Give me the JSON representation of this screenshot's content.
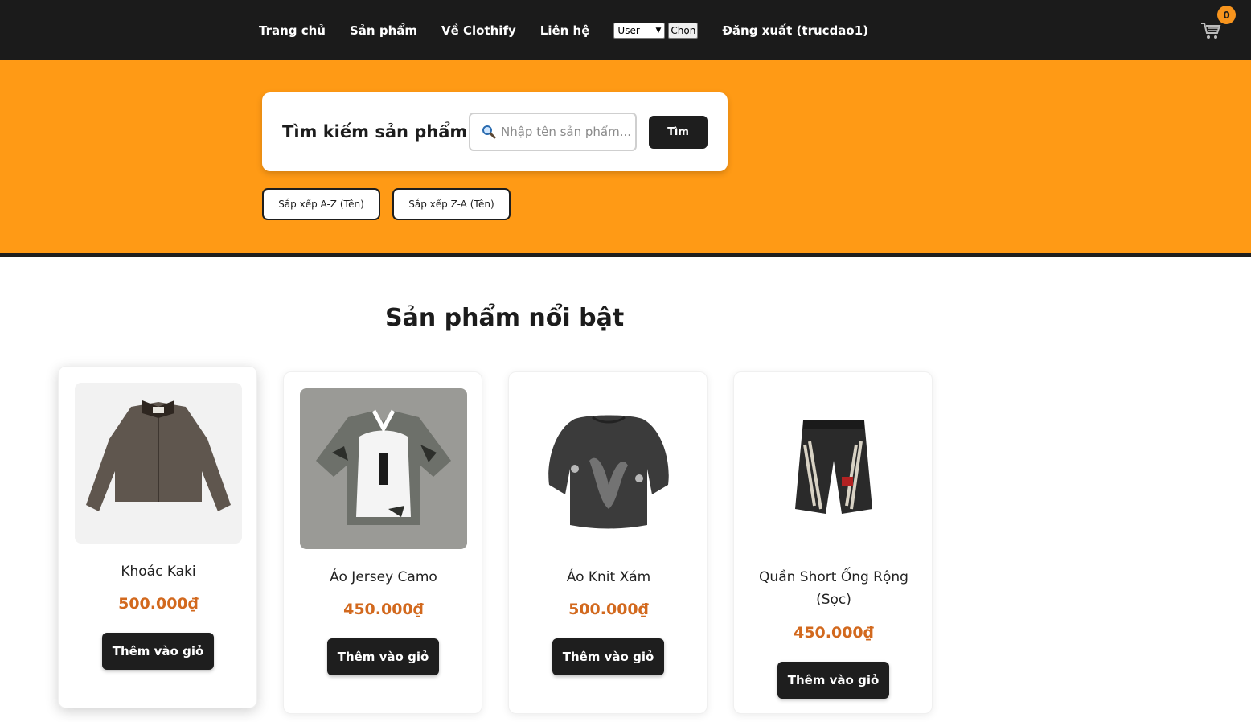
{
  "nav": {
    "home": "Trang chủ",
    "products": "Sản phẩm",
    "about": "Về Clothify",
    "contact": "Liên hệ",
    "role_selected": "User",
    "choose_button": "Chọn",
    "logout": "Đăng xuất (trucdao1)",
    "cart_count": "0",
    "cart_icon": "cart-icon"
  },
  "search": {
    "title": "Tìm kiếm sản phẩm",
    "placeholder": "Nhập tên sản phẩm...",
    "button": "Tìm",
    "icon": "search-icon"
  },
  "sort": {
    "az": "Sắp xếp A-Z (Tên)",
    "za": "Sắp xếp Z-A (Tên)"
  },
  "featured": {
    "title": "Sản phẩm nổi bật",
    "products": [
      {
        "name": "Khoác Kaki",
        "price": "500.000₫",
        "button": "Thêm vào giỏ",
        "image": "brown-jacket-image"
      },
      {
        "name": "Áo Jersey Camo",
        "price": "450.000₫",
        "button": "Thêm vào giỏ",
        "image": "camo-jersey-image"
      },
      {
        "name": "Áo Knit Xám",
        "price": "500.000₫",
        "button": "Thêm vào giỏ",
        "image": "grey-knit-sweater-image"
      },
      {
        "name": "Quần Short Ống Rộng (Sọc)",
        "price": "450.000₫",
        "button": "Thêm vào giỏ",
        "image": "striped-shorts-image"
      }
    ]
  },
  "colors": {
    "header_bg": "#1b1b1b",
    "hero_bg": "#ff9a15",
    "price": "#d2691e",
    "button_bg": "#1e1e1e",
    "badge": "#f7941d"
  }
}
